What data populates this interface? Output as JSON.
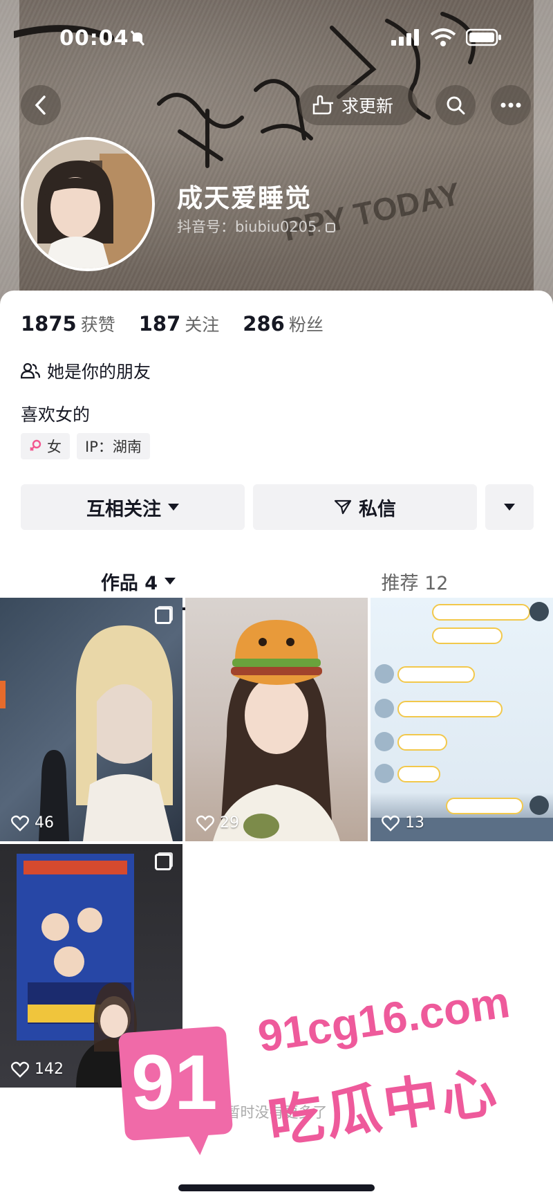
{
  "status_bar": {
    "time": "00:04"
  },
  "header": {
    "update_label": "求更新",
    "nickname": "成天爱睡觉",
    "douyin_id": "抖音号：biubiu0205."
  },
  "stats": [
    {
      "value": "1875",
      "label": "获赞"
    },
    {
      "value": "187",
      "label": "关注"
    },
    {
      "value": "286",
      "label": "粉丝"
    }
  ],
  "friend_text": "她是你的朋友",
  "bio": "喜欢女的",
  "tags": {
    "gender": "女",
    "ip": "IP：湖南"
  },
  "actions": {
    "follow": "互相关注",
    "message": "私信"
  },
  "tabs": {
    "works": "作品 4",
    "recommend": "推荐 12"
  },
  "posts": [
    {
      "likes": "46"
    },
    {
      "likes": "29"
    },
    {
      "likes": "13"
    },
    {
      "likes": "142"
    }
  ],
  "end_text": "暂时没有更多了",
  "watermark": {
    "number": "91",
    "url": "91cg16.com",
    "name": "吃瓜中心"
  },
  "colors": {
    "accent_pink": "#ee5a9b",
    "text": "#161823"
  }
}
